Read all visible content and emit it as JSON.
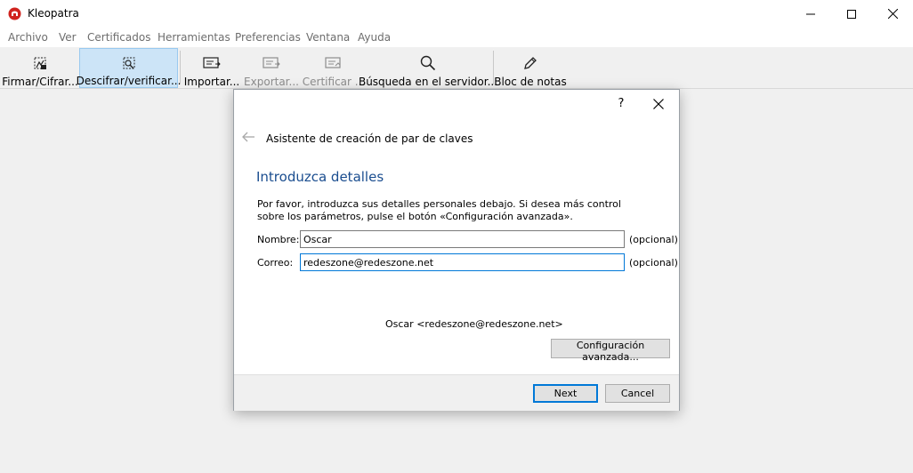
{
  "window": {
    "title": "Kleopatra"
  },
  "menu": [
    "Archivo",
    "Ver",
    "Certificados",
    "Herramientas",
    "Preferencias",
    "Ventana",
    "Ayuda"
  ],
  "toolbar": {
    "sign_encrypt": "Firmar/Cifrar...",
    "decrypt_verify": "Descifrar/verificar...",
    "import": "Importar...",
    "export": "Exportar...",
    "certify": "Certificar ...",
    "lookup_server": "Búsqueda en el servidor...",
    "notepad": "Bloc de notas"
  },
  "dialog": {
    "help": "?",
    "title": "Asistente de creación de par de claves",
    "heading": "Introduzca detalles",
    "description": "Por favor, introduzca sus detalles personales debajo. Si desea más control sobre los parámetros, pulse el botón «Configuración avanzada».",
    "name_label": "Nombre:",
    "name_value": "Oscar",
    "email_label": "Correo:",
    "email_value": "redeszone@redeszone.net",
    "optional": "(opcional)",
    "preview": "Oscar <redeszone@redeszone.net>",
    "advanced_button": "Configuración avanzada...",
    "next_button": "Next",
    "cancel_button": "Cancel"
  },
  "colors": {
    "accent": "#0078d7",
    "heading": "#1a4d8f",
    "active_tool": "#cce4f7"
  }
}
